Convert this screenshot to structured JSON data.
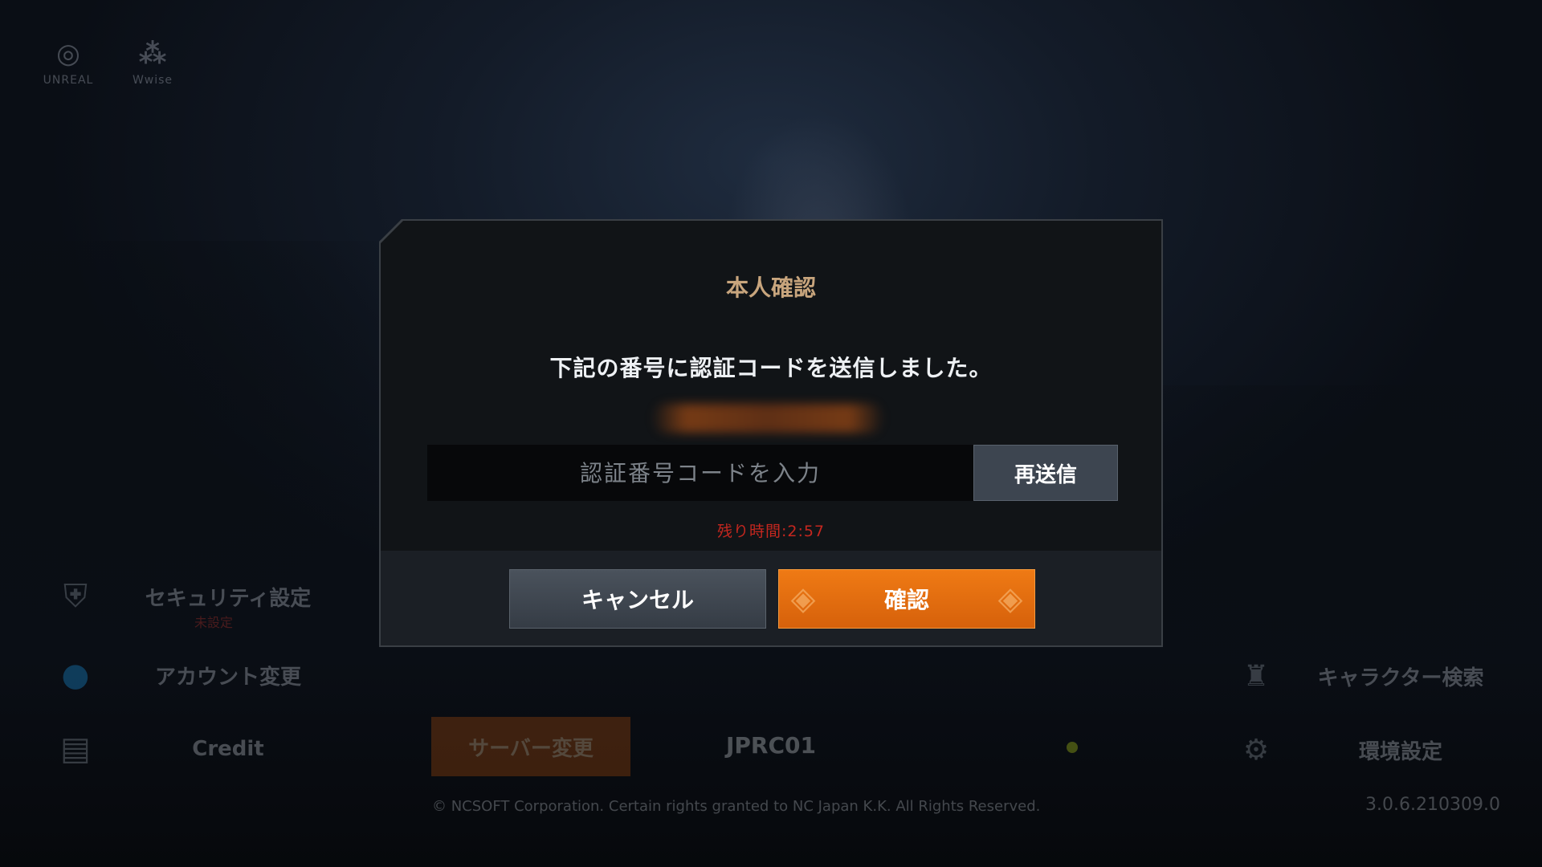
{
  "logos": {
    "unreal_caption": "UNREAL",
    "wwise_caption": "Wwise"
  },
  "left_menu": {
    "security": {
      "label": "セキュリティ設定",
      "status": "未設定",
      "icon": "shield-lock-icon"
    },
    "account": {
      "label": "アカウント変更",
      "icon": "twitter-icon"
    },
    "credit": {
      "label": "Credit",
      "icon": "clapperboard-icon"
    }
  },
  "server": {
    "change_label": "サーバー変更",
    "name": "JPRC01",
    "status_color": "#c5e21b"
  },
  "right_menu": {
    "character_search": {
      "label": "キャラクター検索",
      "icon": "helmet-icon"
    },
    "settings": {
      "label": "環境設定",
      "icon": "gear-icon"
    }
  },
  "copyright": "© NCSOFT Corporation. Certain rights granted to NC Japan K.K. All Rights Reserved.",
  "version": "3.0.6.210309.0",
  "dialog": {
    "title": "本人確認",
    "message": "下記の番号に認証コードを送信しました。",
    "code_input": {
      "value": "",
      "placeholder": "認証番号コードを入力"
    },
    "resend_label": "再送信",
    "timer": "残り時間:2:57",
    "cancel_label": "キャンセル",
    "confirm_label": "確認",
    "colors": {
      "title": "#c8a57d",
      "timer": "#c5271f",
      "confirm": "#e56d10"
    }
  }
}
